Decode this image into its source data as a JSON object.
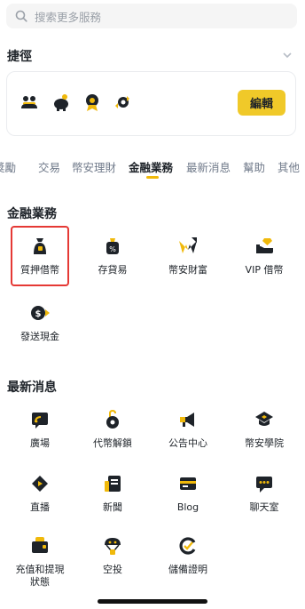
{
  "search": {
    "placeholder": "搜索更多服務"
  },
  "shortcuts": {
    "title": "捷徑",
    "edit_label": "編輯"
  },
  "tabs": [
    "獎勵",
    "交易",
    "幣安理財",
    "金融業務",
    "最新消息",
    "幫助",
    "其他"
  ],
  "active_tab": "金融業務",
  "finance": {
    "title": "金融業務",
    "items": [
      {
        "label": "質押借幣",
        "icon": "collateral-bag-icon"
      },
      {
        "label": "存貸易",
        "icon": "percent-bag-icon"
      },
      {
        "label": "幣安財富",
        "icon": "wealth-w-icon"
      },
      {
        "label": "VIP 借幣",
        "icon": "vip-hand-icon"
      },
      {
        "label": "發送現金",
        "icon": "send-cash-icon"
      }
    ]
  },
  "news": {
    "title": "最新消息",
    "items": [
      {
        "label": "廣場",
        "icon": "square-feed-icon"
      },
      {
        "label": "代幣解鎖",
        "icon": "token-unlock-icon"
      },
      {
        "label": "公告中心",
        "icon": "megaphone-icon"
      },
      {
        "label": "幣安學院",
        "icon": "academy-cap-icon"
      },
      {
        "label": "直播",
        "icon": "live-icon"
      },
      {
        "label": "新聞",
        "icon": "news-icon"
      },
      {
        "label": "Blog",
        "icon": "blog-icon"
      },
      {
        "label": "聊天室",
        "icon": "chat-icon"
      },
      {
        "label": "充值和提現\n狀態",
        "icon": "deposit-status-icon"
      },
      {
        "label": "空投",
        "icon": "airdrop-icon"
      },
      {
        "label": "儲備證明",
        "icon": "proof-of-reserves-icon"
      }
    ]
  },
  "colors": {
    "accent": "#f0b90b",
    "text": "#1e2329",
    "muted": "#707a8a",
    "highlight": "#e53935"
  }
}
